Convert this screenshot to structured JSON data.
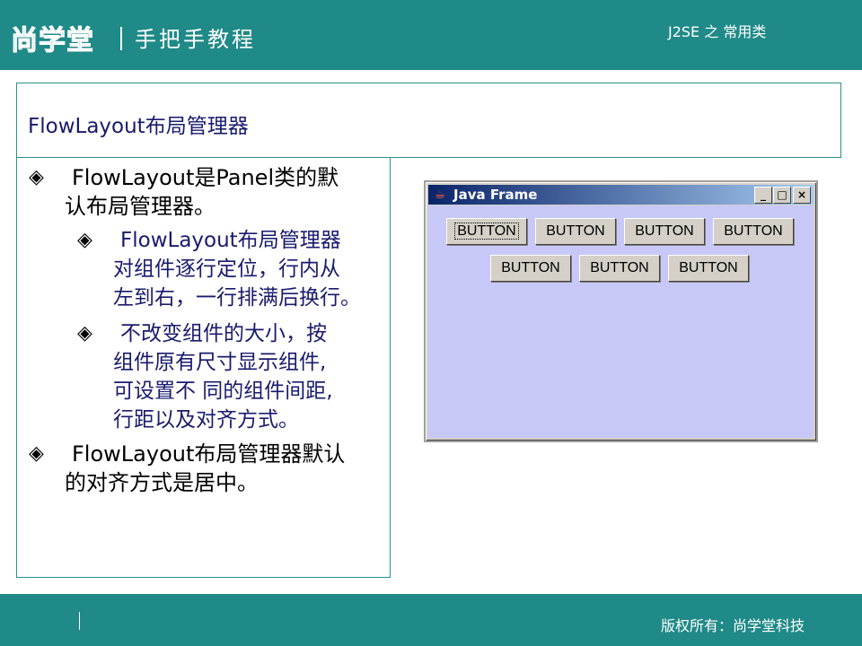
{
  "header": {
    "logo": "尚学堂",
    "tagline": "手把手教程",
    "course": "J2SE 之 常用类"
  },
  "slide": {
    "title": "FlowLayout布局管理器",
    "bullets": [
      {
        "level": 1,
        "lines": [
          "FlowLayout是Panel类的默",
          "认布局管理器。"
        ]
      },
      {
        "level": 2,
        "lines": [
          "FlowLayout布局管理器",
          "对组件逐行定位，行内从",
          "左到右，一行排满后换行。"
        ]
      },
      {
        "level": 2,
        "lines": [
          "不改变组件的大小，按",
          "组件原有尺寸显示组件,",
          "可设置不  同的组件间距,",
          "行距以及对齐方式。"
        ]
      },
      {
        "level": 1,
        "lines": [
          "FlowLayout布局管理器默认",
          "的对齐方式是居中。"
        ]
      }
    ]
  },
  "java_frame": {
    "title": "Java Frame",
    "minimize": "_",
    "maximize": "□",
    "close": "×",
    "buttons_row1": [
      "BUTTON",
      "BUTTON",
      "BUTTON",
      "BUTTON"
    ],
    "buttons_row2": [
      "BUTTON",
      "BUTTON",
      "BUTTON"
    ]
  },
  "footer": {
    "copyright": "版权所有：尚学堂科技"
  },
  "colors": {
    "header_bg": "#1f8a87",
    "frame_content_bg": "#c8c8f8",
    "sub_bullet_text": "#1a1a6e"
  }
}
